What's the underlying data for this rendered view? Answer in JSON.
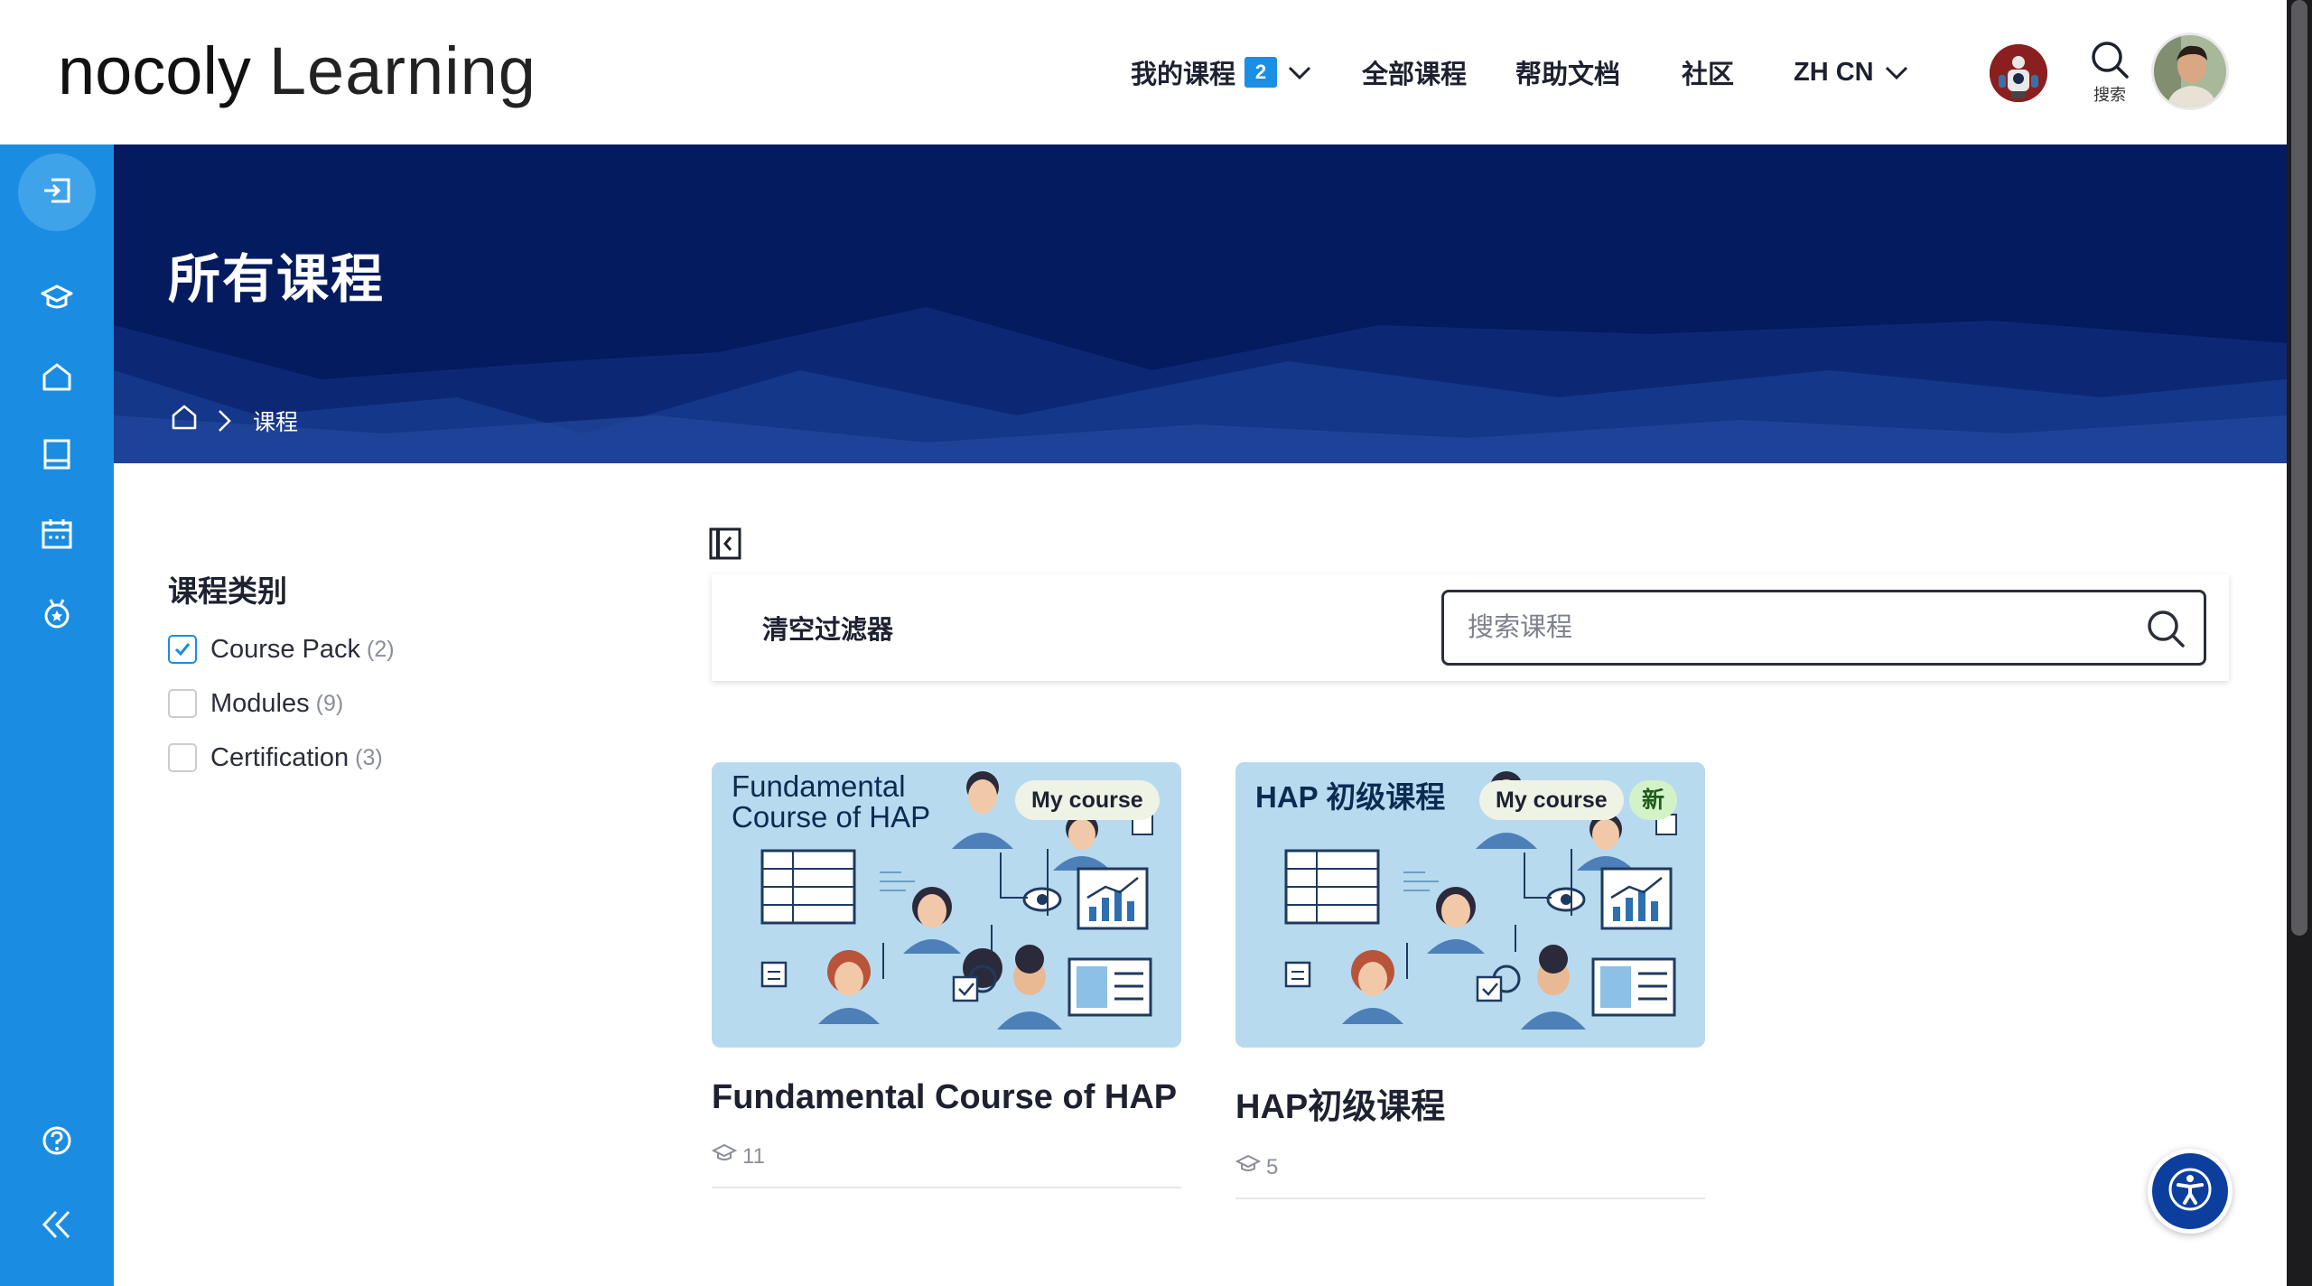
{
  "header": {
    "brand": "nocoly",
    "product": "Learning",
    "nav": {
      "my_courses": "我的课程",
      "my_courses_count": "2",
      "all_courses": "全部课程",
      "help_docs": "帮助文档",
      "community": "社区",
      "language": "ZH CN"
    },
    "search_label": "搜索"
  },
  "hero": {
    "title": "所有课程",
    "breadcrumb_current": "课程"
  },
  "filters": {
    "title": "课程类别",
    "items": [
      {
        "label": "Course Pack",
        "count": "(2)",
        "checked": true
      },
      {
        "label": "Modules",
        "count": "(9)",
        "checked": false
      },
      {
        "label": "Certification",
        "count": "(3)",
        "checked": false
      }
    ]
  },
  "toolbar": {
    "clear_label": "清空过滤器",
    "search_placeholder": "搜索课程"
  },
  "courses": [
    {
      "thumb_title": "Fundamental Course of HAP",
      "pill": "My course",
      "title": "Fundamental Course of HAP",
      "count": "11"
    },
    {
      "thumb_title": "HAP 初级课程",
      "pill": "My course",
      "new_badge": "新",
      "title": "HAP初级课程",
      "count": "5"
    }
  ],
  "colors": {
    "rail": "#1a8de2",
    "hero": "#041b5f",
    "accent": "#1a8fe3",
    "thumb": "#b7d9ee"
  },
  "icons": [
    "exit-icon",
    "graduation-cap-icon",
    "home-icon",
    "book-icon",
    "calendar-icon",
    "award-icon",
    "help-icon",
    "collapse-icon",
    "search-icon",
    "chevron-down-icon",
    "panel-toggle-icon",
    "accessibility-icon"
  ]
}
